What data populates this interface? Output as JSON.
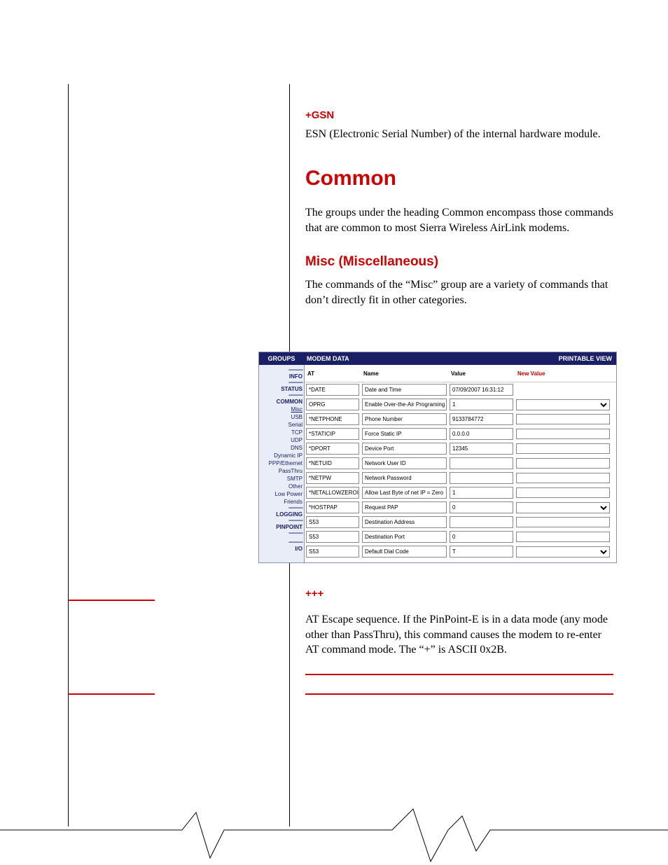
{
  "sections": {
    "gsn": {
      "heading": "+GSN",
      "body": "ESN (Electronic Serial Number) of the internal hardware module."
    },
    "common": {
      "heading": "Common",
      "body": "The groups under the heading Common encompass those commands that are common to most Sierra Wireless AirLink modems."
    },
    "misc": {
      "heading": "Misc (Miscellaneous)",
      "body": "The commands of the “Misc” group are a variety of commands that don’t directly fit in other categories."
    },
    "escape": {
      "heading": "+++",
      "body": "AT Escape sequence. If the PinPoint-E is in a data mode (any mode other than PassThru), this command causes the modem to re-enter AT command mode. The “+” is ASCII 0x2B."
    }
  },
  "ui": {
    "header": {
      "groups": "GROUPS",
      "modem_data": "MODEM DATA",
      "printable": "PRINTABLE VIEW"
    },
    "sidebar": {
      "sep": "---------------",
      "items": [
        "INFO",
        "STATUS",
        "COMMON"
      ],
      "sub": [
        "Misc",
        "USB",
        "Serial",
        "TCP",
        "UDP",
        "DNS",
        "Dynamic IP",
        "PPP/Ethernet",
        "PassThru",
        "SMTP",
        "Other",
        "Low Power",
        "Friends"
      ],
      "items2": [
        "LOGGING",
        "PINPOINT"
      ],
      "items3": [
        "I/O"
      ]
    },
    "columns": {
      "at": "AT",
      "name": "Name",
      "value": "Value",
      "new_value": "New Value"
    },
    "rows": [
      {
        "at": "*DATE",
        "name": "Date and Time",
        "value": "07/09/2007 16:31:12",
        "control": "none"
      },
      {
        "at": "OPRG",
        "name": "Enable Over-the-Air Programing",
        "value": "1",
        "control": "select"
      },
      {
        "at": "*NETPHONE",
        "name": "Phone Number",
        "value": "9133784772",
        "control": "input"
      },
      {
        "at": "*STATICIP",
        "name": "Force Static IP",
        "value": "0.0.0.0",
        "control": "input"
      },
      {
        "at": "*DPORT",
        "name": "Device Port",
        "value": "12345",
        "control": "input"
      },
      {
        "at": "*NETUID",
        "name": "Network User ID",
        "value": "",
        "control": "input"
      },
      {
        "at": "*NETPW",
        "name": "Network Password",
        "value": "",
        "control": "input"
      },
      {
        "at": "*NETALLOWZEROIP",
        "name": "Allow Last Byte of net IP = Zero",
        "value": "1",
        "control": "input"
      },
      {
        "at": "*HOSTPAP",
        "name": "Request PAP",
        "value": "0",
        "control": "select"
      },
      {
        "at": "S53",
        "name": "Destination Address",
        "value": "",
        "control": "input"
      },
      {
        "at": "S53",
        "name": "Destination Port",
        "value": "0",
        "control": "input"
      },
      {
        "at": "S53",
        "name": "Default Dial Code",
        "value": "T",
        "control": "select"
      }
    ]
  }
}
